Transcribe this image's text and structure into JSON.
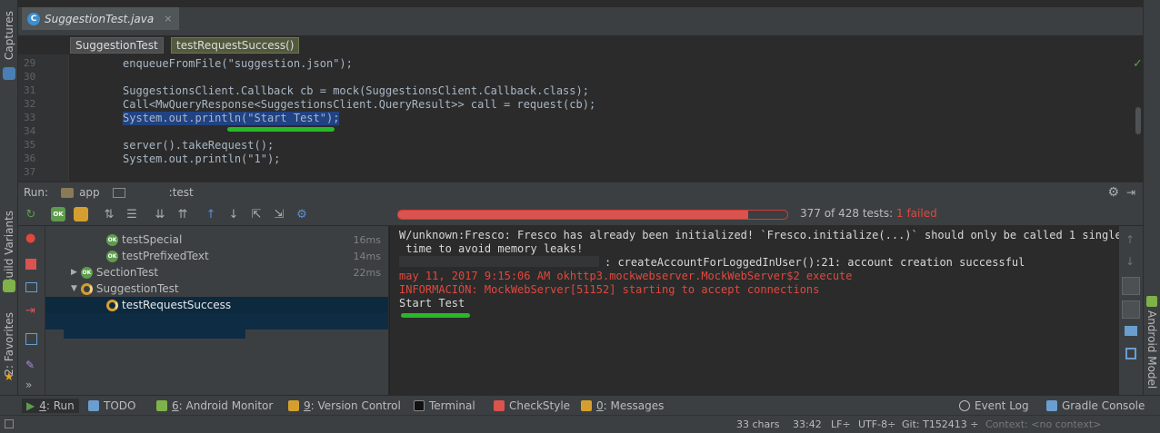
{
  "side_left": {
    "captures": "Captures",
    "build_variants": "Build Variants",
    "favorites": "2: Favorites"
  },
  "side_right": {
    "android_model": "Android Model"
  },
  "editor": {
    "tab_label": "SuggestionTest.java",
    "tab_close": "×",
    "tab_icon": "C",
    "breadcrumbs": [
      "SuggestionTest",
      "testRequestSuccess()"
    ],
    "lines": [
      {
        "num": "29",
        "text": "enqueueFromFile(\"suggestion.json\");"
      },
      {
        "num": "30",
        "text": ""
      },
      {
        "num": "31",
        "text": "SuggestionsClient.Callback cb = mock(SuggestionsClient.Callback.class);"
      },
      {
        "num": "32",
        "text": "Call<MwQueryResponse<SuggestionsClient.QueryResult>> call = request(cb);"
      },
      {
        "num": "33",
        "text": "System.out.println(\"Start Test\");"
      },
      {
        "num": "34",
        "text": ""
      },
      {
        "num": "35",
        "text": "server().takeRequest();"
      },
      {
        "num": "36",
        "text": "System.out.println(\"1\");"
      },
      {
        "num": "37",
        "text": ""
      }
    ]
  },
  "run_panel": {
    "label": "Run:",
    "config_app": "app",
    "config_test": ":test",
    "progress": {
      "passed_fraction": 0.9,
      "text": "377 of 428 tests:",
      "failed_text": "1 failed"
    },
    "tree": [
      {
        "name": "testSpecial",
        "duration": "16ms",
        "status": "ok"
      },
      {
        "name": "testPrefixedText",
        "duration": "14ms",
        "status": "ok"
      },
      {
        "name": "SectionTest",
        "duration": "22ms",
        "status": "ok",
        "expanded": false
      },
      {
        "name": "SuggestionTest",
        "duration": "",
        "status": "running",
        "expanded": true
      },
      {
        "name": "testRequestSuccess",
        "duration": "",
        "status": "running",
        "selected": true
      }
    ],
    "console": [
      {
        "text": "W/unknown:Fresco: Fresco has already been initialized! `Fresco.initialize(...)` should only be called 1 single",
        "color": "normal"
      },
      {
        "text": " time to avoid memory leaks!",
        "color": "normal"
      },
      {
        "text": ": createAccountForLoggedInUser():21: account creation successful",
        "color": "normal"
      },
      {
        "text": "may 11, 2017 9:15:06 AM okhttp3.mockwebserver.MockWebServer$2 execute",
        "color": "red"
      },
      {
        "text": "INFORMACIÓN: MockWebServer[51152] starting to accept connections",
        "color": "red"
      },
      {
        "text": "Start Test",
        "color": "normal"
      }
    ]
  },
  "toolwindows": [
    {
      "mnemonic": "4",
      "label": ": Run",
      "active": true
    },
    {
      "mnemonic": "",
      "label": "TODO",
      "active": false
    },
    {
      "mnemonic": "6",
      "label": ": Android Monitor",
      "active": false
    },
    {
      "mnemonic": "9",
      "label": ": Version Control",
      "active": false
    },
    {
      "mnemonic": "",
      "label": "Terminal",
      "active": false
    },
    {
      "mnemonic": "",
      "label": "CheckStyle",
      "active": false
    },
    {
      "mnemonic": "0",
      "label": ": Messages",
      "active": false
    },
    {
      "mnemonic": "",
      "label": "Event Log",
      "active": false
    },
    {
      "mnemonic": "",
      "label": "Gradle Console",
      "active": false
    }
  ],
  "status": {
    "chars": "33 chars",
    "position": "33:42",
    "line_sep": "LF÷",
    "encoding": "UTF-8÷",
    "git": "Git: T152413 ÷",
    "context": "Context: <no context>"
  },
  "colors": {
    "passed": "#5d9b4d",
    "failed": "#d9534f",
    "selection": "#214283"
  }
}
